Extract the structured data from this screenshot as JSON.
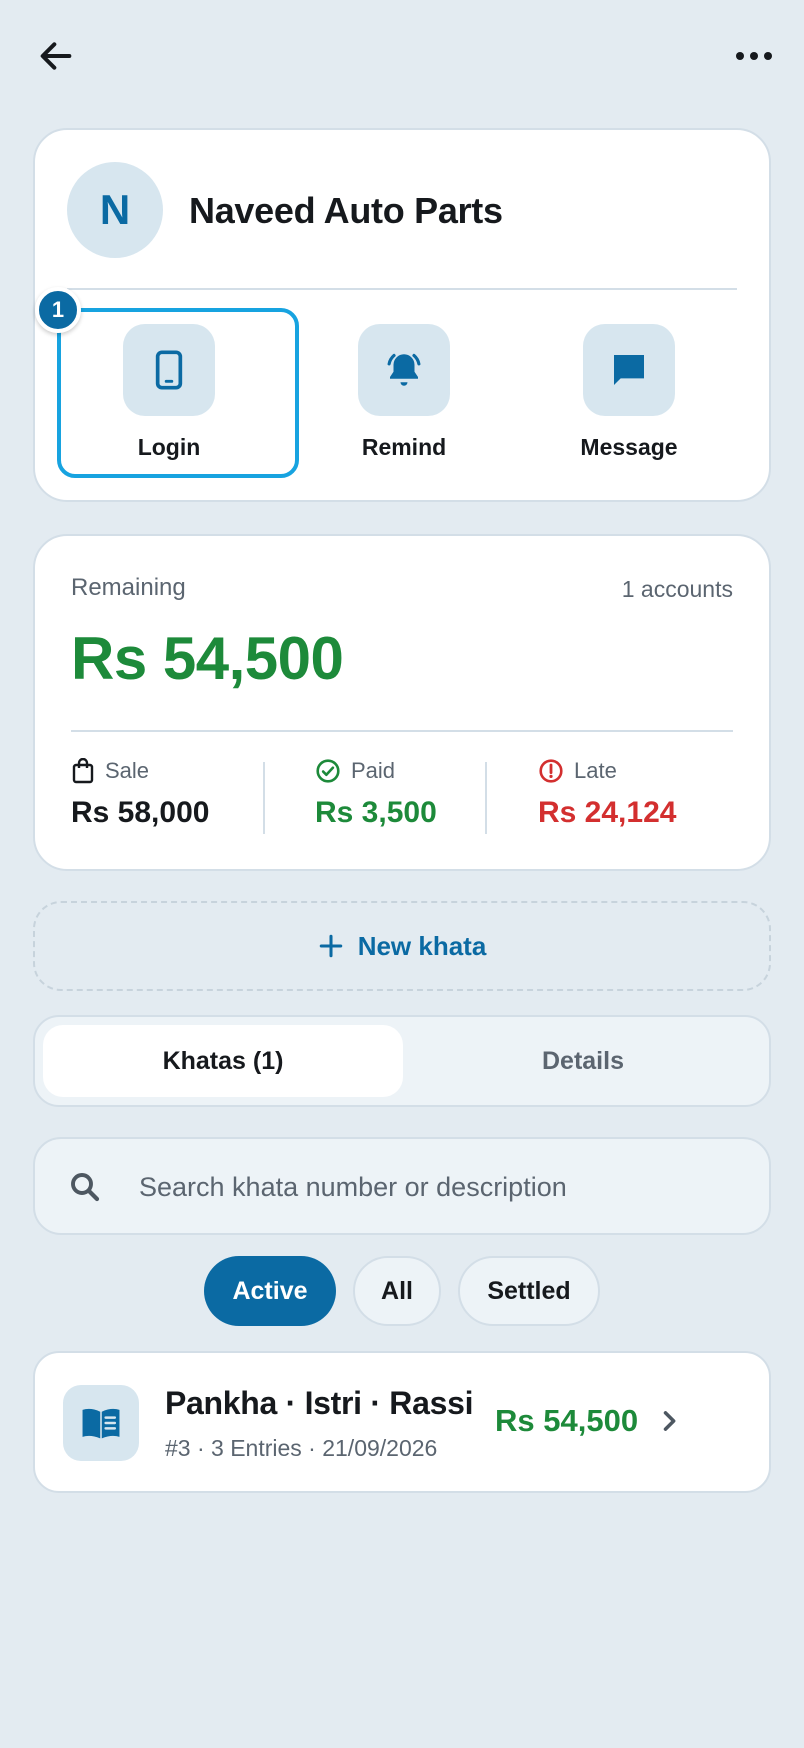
{
  "profile": {
    "avatar_letter": "N",
    "name": "Naveed Auto Parts",
    "step_badge": "1",
    "actions": [
      {
        "label": "Login",
        "icon": "phone-icon"
      },
      {
        "label": "Remind",
        "icon": "bell-icon"
      },
      {
        "label": "Message",
        "icon": "chat-icon"
      }
    ]
  },
  "balance": {
    "remaining_label": "Remaining",
    "accounts_count": "1 accounts",
    "remaining_amount": "Rs 54,500",
    "stats": [
      {
        "label": "Sale",
        "value": "Rs 58,000",
        "icon": "bag-icon",
        "color": "#16191d"
      },
      {
        "label": "Paid",
        "value": "Rs 3,500",
        "icon": "check-circle-icon",
        "color": "#1d8a3a"
      },
      {
        "label": "Late",
        "value": "Rs 24,124",
        "icon": "alert-circle-icon",
        "color": "#d32f2f"
      }
    ]
  },
  "new_khata": {
    "label": "New khata"
  },
  "tabs": [
    {
      "label": "Khatas (1)",
      "selected": true
    },
    {
      "label": "Details",
      "selected": false
    }
  ],
  "search": {
    "placeholder": "Search khata number or description",
    "value": ""
  },
  "filters": [
    {
      "label": "Active",
      "selected": true
    },
    {
      "label": "All",
      "selected": false
    },
    {
      "label": "Settled",
      "selected": false
    }
  ],
  "khatas": [
    {
      "title": "Pankha · Istri · Rassi",
      "meta": "#3 · 3 Entries · 21/09/2026",
      "amount": "Rs 54,500"
    }
  ],
  "colors": {
    "accent": "#0b6aa3",
    "highlight": "#17a3e0",
    "positive": "#1d8a3a",
    "negative": "#d32f2f",
    "background": "#e3ebf1"
  }
}
